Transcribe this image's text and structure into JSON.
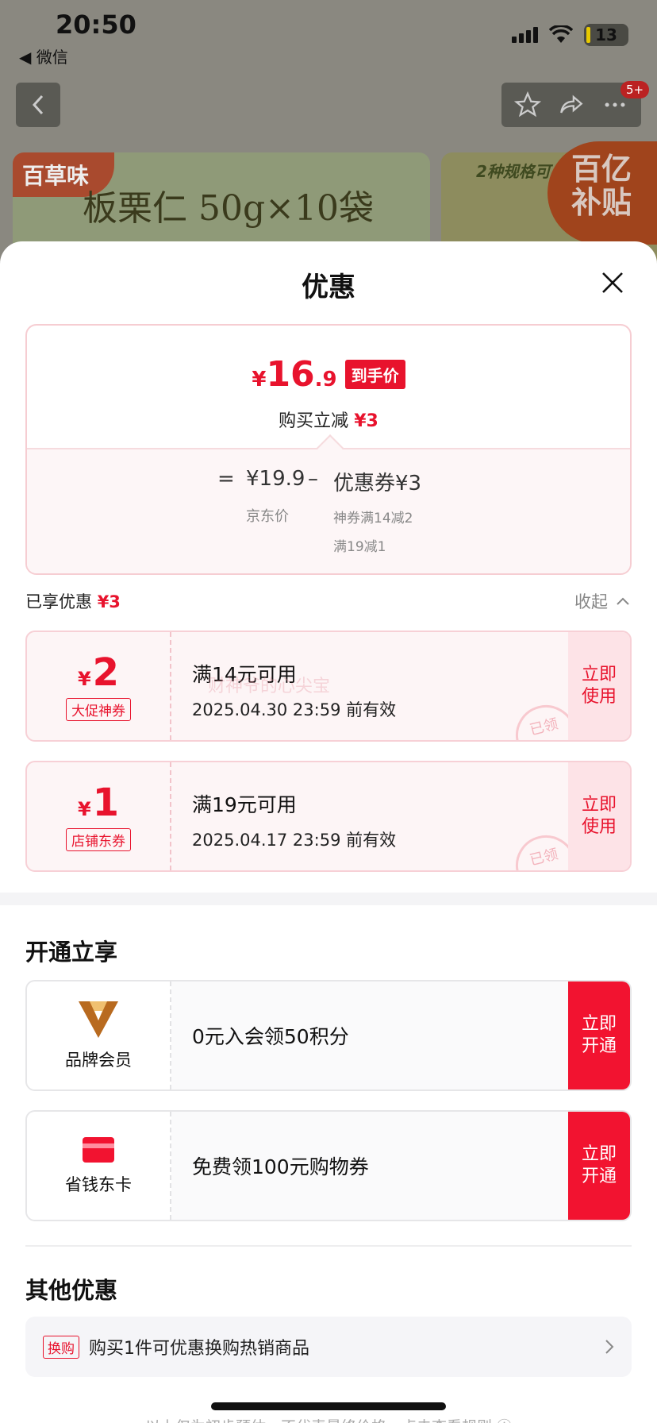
{
  "status_bar": {
    "time": "20:50",
    "back_app": "◀ 微信",
    "battery": "13"
  },
  "nav": {
    "badge": "5+"
  },
  "background": {
    "brand": "百草味",
    "product_title": "板栗仁 50g×10袋",
    "spec_label": "2种规格可",
    "subsidy_line1": "百亿",
    "subsidy_line2": "补贴"
  },
  "sheet": {
    "title": "优惠",
    "price": {
      "symbol": "¥",
      "integer": "16",
      "decimal": ".9",
      "tag": "到手价",
      "instant_label": "购买立减",
      "instant_amount": "¥3",
      "equals": "=",
      "base_price": "¥19.9",
      "base_label": "京东价",
      "minus": "–",
      "coupon_label": "优惠券¥3",
      "coupon_detail_1": "神券满14减2",
      "coupon_detail_2": "满19减1"
    },
    "enjoyed": {
      "label": "已享优惠",
      "amount": "¥3",
      "collapse_label": "收起"
    },
    "watermark": "财神爷的心尖宝",
    "coupons": [
      {
        "symbol": "¥",
        "amount": "2",
        "type": "大促神券",
        "condition": "满14元可用",
        "validity": "2025.04.30 23:59 前有效",
        "action": "立即使用",
        "stamp": "已领"
      },
      {
        "symbol": "¥",
        "amount": "1",
        "type": "店铺东券",
        "condition": "满19元可用",
        "validity": "2025.04.17 23:59 前有效",
        "action": "立即使用",
        "stamp": "已领"
      }
    ],
    "open_section": {
      "title": "开通立享",
      "items": [
        {
          "name": "品牌会员",
          "icon": "brand-v-icon",
          "text": "0元入会领50积分",
          "action": "立即开通"
        },
        {
          "name": "省钱东卡",
          "icon": "red-card-icon",
          "text": "免费领100元购物券",
          "action": "立即开通"
        }
      ]
    },
    "other_section": {
      "title": "其他优惠",
      "tag": "换购",
      "text": "购买1件可优惠换购热销商品"
    },
    "footer_note": "以上仅为初步预估，不代表最终价格，点击查看规则 ⓘ"
  },
  "colors": {
    "accent": "#e8132d",
    "pink_bg": "#fdf5f6",
    "action_red": "#f21330"
  }
}
